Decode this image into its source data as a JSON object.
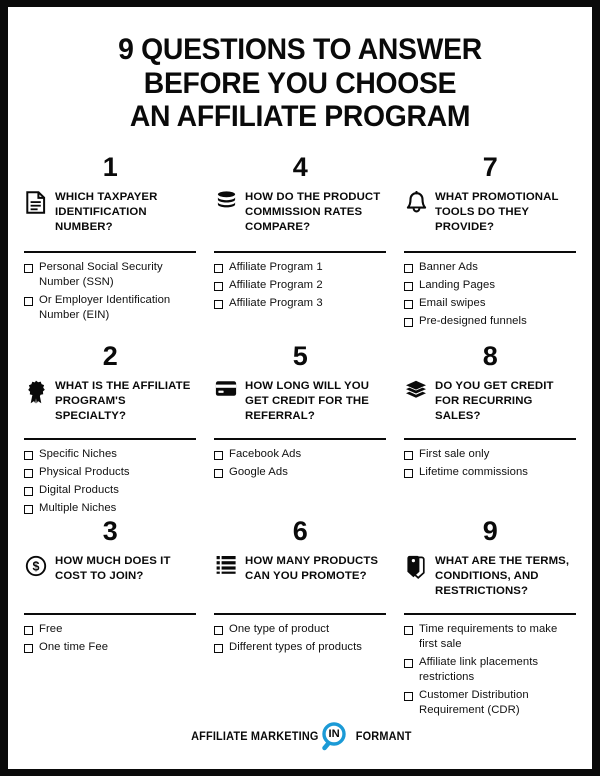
{
  "frame": {
    "border_color": "#0a0a0a",
    "background_color": "#ffffff"
  },
  "title": {
    "line1": "9 QUESTIONS TO ANSWER",
    "line2": "BEFORE YOU CHOOSE",
    "line3": "AN AFFILIATE PROGRAM"
  },
  "questions": [
    {
      "number": "1",
      "icon": "document-icon",
      "heading": "WHICH TAXPAYER IDENTIFICATION NUMBER?",
      "options": [
        "Personal Social Security Number (SSN)",
        "Or Employer Identification Number (EIN)"
      ]
    },
    {
      "number": "4",
      "icon": "coin-stack-icon",
      "heading": "HOW DO THE PRODUCT COMMISSION RATES COMPARE?",
      "options": [
        "Affiliate Program 1",
        "Affiliate Program 2",
        "Affiliate Program 3"
      ]
    },
    {
      "number": "7",
      "icon": "bell-icon",
      "heading": "WHAT PROMOTIONAL TOOLS DO THEY PROVIDE?",
      "options": [
        "Banner Ads",
        "Landing Pages",
        "Email swipes",
        "Pre-designed funnels"
      ]
    },
    {
      "number": "2",
      "icon": "award-ribbon-icon",
      "heading": "WHAT IS THE AFFILIATE PROGRAM'S SPECIALTY?",
      "options": [
        "Specific Niches",
        "Physical Products",
        "Digital Products",
        "Multiple Niches"
      ]
    },
    {
      "number": "5",
      "icon": "credit-card-icon",
      "heading": "HOW LONG WILL YOU GET CREDIT FOR THE REFERRAL?",
      "options": [
        "Facebook Ads",
        "Google Ads"
      ]
    },
    {
      "number": "8",
      "icon": "layers-icon",
      "heading": "DO YOU GET CREDIT FOR RECURRING SALES?",
      "options": [
        "First sale only",
        "Lifetime commissions"
      ]
    },
    {
      "number": "3",
      "icon": "dollar-coin-icon",
      "heading": "HOW MUCH DOES IT COST TO JOIN?",
      "options": [
        "Free",
        "One time Fee"
      ]
    },
    {
      "number": "6",
      "icon": "list-icon",
      "heading": "HOW MANY PRODUCTS CAN YOU PROMOTE?",
      "options": [
        "One type of product",
        "Different types of products"
      ]
    },
    {
      "number": "9",
      "icon": "tag-icon",
      "heading": "WHAT ARE THE TERMS, CONDITIONS, AND RESTRICTIONS?",
      "options": [
        "Time requirements to make first sale",
        "Affiliate link placements restrictions",
        "Customer Distribution Requirement (CDR)"
      ]
    }
  ],
  "footer": {
    "logo_text_before": "AFFILIATE MARKETING",
    "logo_mark_text": "IN",
    "logo_text_after": "FORMANT",
    "logo_accent_color": "#1b9ad6"
  }
}
